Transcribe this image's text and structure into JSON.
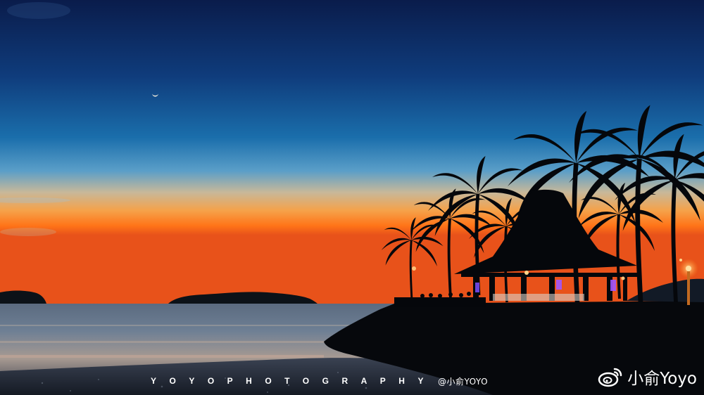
{
  "watermark": {
    "spaced_text": "YOYOPHOTOGRAPHY",
    "handle": "@小俞YOYO"
  },
  "weibo": {
    "icon": "weibo-logo-icon",
    "name": "小俞Yoyo"
  },
  "colors": {
    "sky_top": "#0b1f4f",
    "sky_mid": "#1768a8",
    "horizon_glow": "#ff6a10",
    "silhouette": "#06080c",
    "lamp": "#ffb347",
    "accent_lights": "#9b4dff"
  }
}
